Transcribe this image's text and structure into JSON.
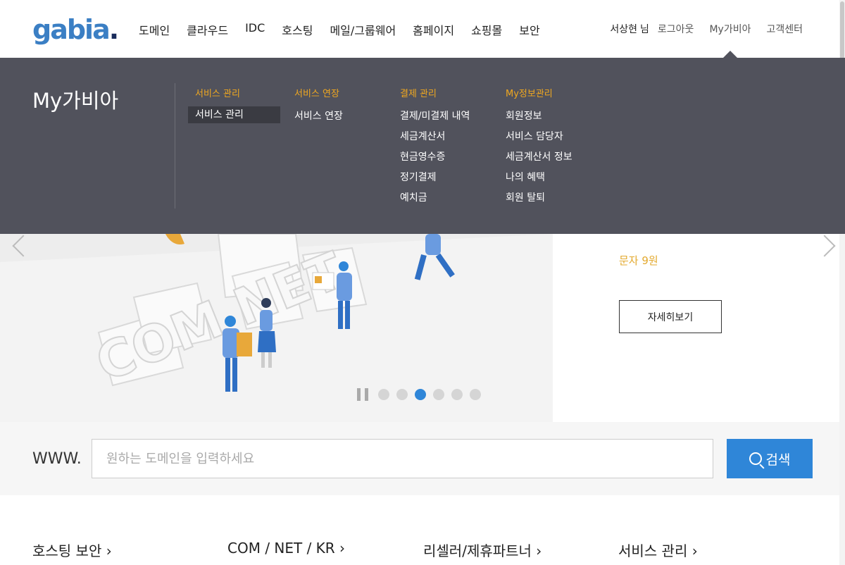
{
  "logo": {
    "text": "gabia",
    "dot": "."
  },
  "gnb": [
    "도메인",
    "클라우드",
    "IDC",
    "호스팅",
    "메일/그룹웨어",
    "홈페이지",
    "쇼핑몰",
    "보안"
  ],
  "util": {
    "user": "서상현",
    "user_suffix": "님",
    "logout": "로그아웃",
    "mygabia": "My가비아",
    "support": "고객센터"
  },
  "mega_menu": {
    "title": "My가비아",
    "columns": [
      {
        "head": "서비스 관리",
        "items": [
          "서비스 관리"
        ]
      },
      {
        "head": "서비스 연장",
        "items": [
          "서비스 연장"
        ]
      },
      {
        "head": "결제 관리",
        "items": [
          "결제/미결제 내역",
          "세금계산서",
          "현금영수증",
          "정기결제",
          "예치금"
        ]
      },
      {
        "head": "My정보관리",
        "items": [
          "회원정보",
          "서비스 담당자",
          "세금계산서 정보",
          "나의 혜택",
          "회원 탈퇴"
        ]
      }
    ]
  },
  "banner": {
    "price": "문자 9원",
    "detail_label": "자세히보기",
    "pager_count": 6,
    "pager_active_index": 2,
    "art_text": "COM NET"
  },
  "search": {
    "prefix": "WWW.",
    "placeholder": "원하는 도메인을 입력하세요",
    "button_label": "검색"
  },
  "quick_links": [
    "호스팅 보안  ›",
    "COM / NET / KR  ›",
    "리셀러/제휴파트너  ›",
    "서비스 관리  ›"
  ],
  "colors": {
    "accent": "#2f86d8",
    "menu_bg": "#51525c",
    "menu_head": "#f0a820",
    "price": "#e3a92e"
  }
}
